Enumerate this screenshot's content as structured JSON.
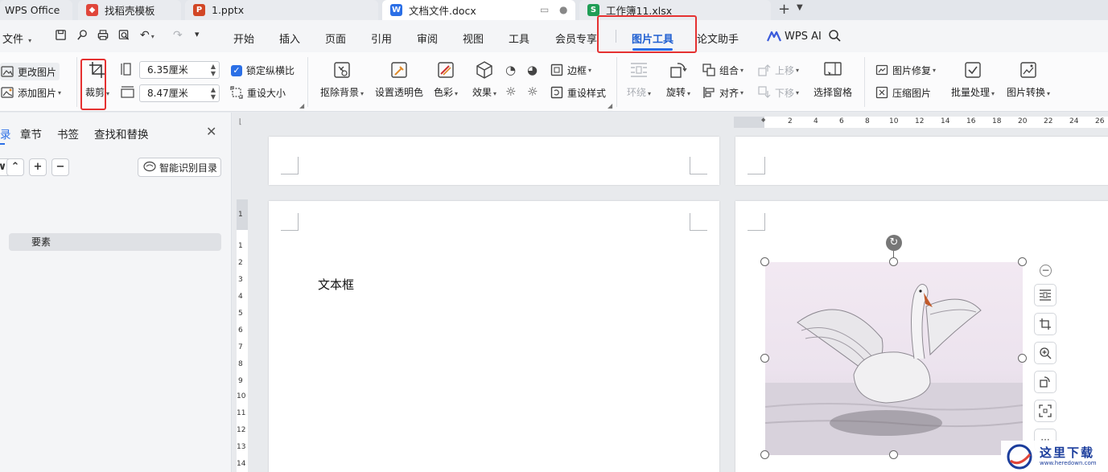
{
  "tabs": [
    {
      "label": "WPS Office",
      "icon": "wps-logo-icon",
      "active": false
    },
    {
      "label": "找稻壳模板",
      "icon": "docer-icon",
      "active": false
    },
    {
      "label": "1.pptx",
      "icon": "powerpoint-icon",
      "badge": "P",
      "active": false
    },
    {
      "label": "文档文件.docx",
      "icon": "writer-icon",
      "badge": "W",
      "active": true
    },
    {
      "label": "工作簿11.xlsx",
      "icon": "spreadsheet-icon",
      "badge": "S",
      "active": false
    }
  ],
  "menu": {
    "file_label": "文件",
    "items": [
      "开始",
      "插入",
      "页面",
      "引用",
      "审阅",
      "视图",
      "工具",
      "会员专享",
      "图片工具",
      "论文助手"
    ],
    "active": "图片工具",
    "ai_label": "WPS AI"
  },
  "ribbon": {
    "change_picture": "更改图片",
    "add_picture": "添加图片",
    "crop": "裁剪",
    "height_value": "6.35厘米",
    "width_value": "8.47厘米",
    "lock_ratio": "锁定纵横比",
    "reset_size": "重设大小",
    "remove_background": "抠除背景",
    "set_transparent": "设置透明色",
    "color": "色彩",
    "effects": "效果",
    "border": "边框",
    "reset_style": "重设样式",
    "wrap": "环绕",
    "rotate": "旋转",
    "group": "组合",
    "align": "对齐",
    "bring_forward": "上移",
    "send_backward": "下移",
    "selection_pane": "选择窗格",
    "picture_repair": "图片修复",
    "compress_picture": "压缩图片",
    "batch_process": "批量处理",
    "picture_convert": "图片转换"
  },
  "nav": {
    "tabs": [
      "录",
      "章节",
      "书签",
      "查找和替换"
    ],
    "smart_toc": "智能识别目录",
    "toc_items": [
      "要素"
    ]
  },
  "ruler": {
    "h_ticks": [
      "2",
      "4",
      "6",
      "8",
      "10",
      "12",
      "14",
      "16",
      "18",
      "20",
      "22",
      "24",
      "26"
    ],
    "v_ticks": [
      "1",
      "1",
      "2",
      "3",
      "4",
      "5",
      "6",
      "7",
      "8",
      "9",
      "10",
      "11",
      "12",
      "13",
      "14"
    ]
  },
  "document": {
    "textbox_text": "文本框"
  },
  "watermark": {
    "main": "这里下载",
    "sub": "www.heredown.com"
  },
  "colors": {
    "accent": "#2b6fe6",
    "highlight": "#e53131",
    "writer": "#2b6fe6",
    "powerpoint": "#d24726",
    "spreadsheet": "#1f9d55"
  }
}
